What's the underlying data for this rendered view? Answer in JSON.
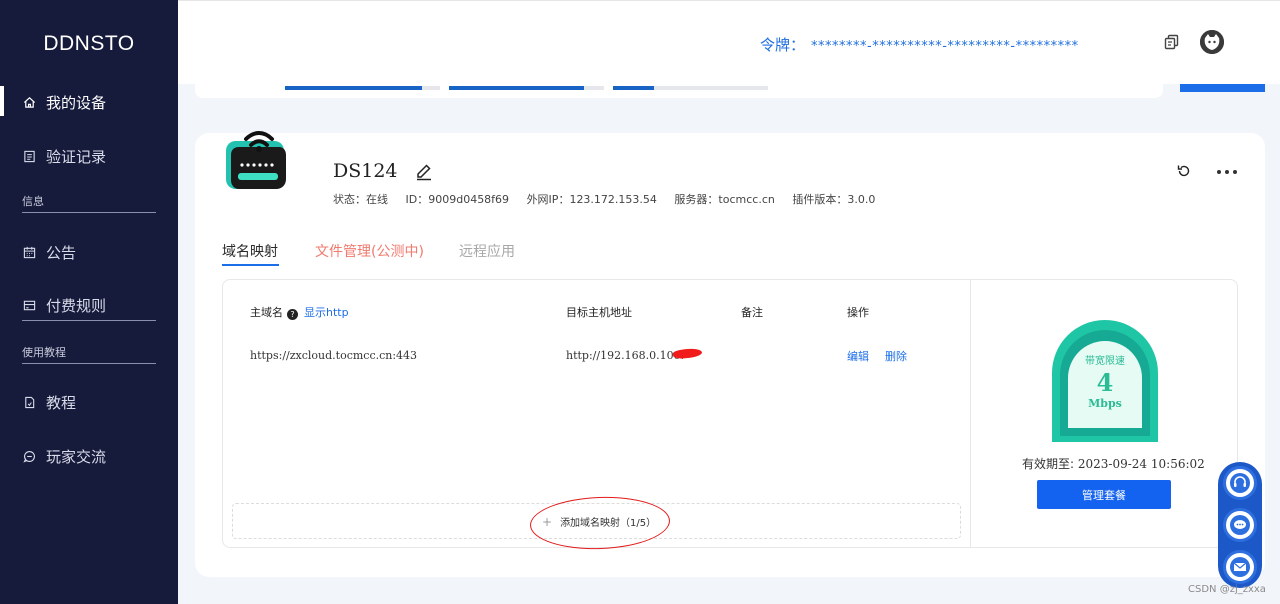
{
  "app": {
    "logo": "DDNSTO"
  },
  "sidebar": {
    "items": [
      {
        "label": "我的设备",
        "icon": "home-icon"
      },
      {
        "label": "验证记录",
        "icon": "list-icon"
      },
      {
        "label": "公告",
        "icon": "calendar-icon"
      },
      {
        "label": "付费规则",
        "icon": "card-icon"
      },
      {
        "label": "教程",
        "icon": "document-icon"
      },
      {
        "label": "玩家交流",
        "icon": "chat-icon"
      }
    ],
    "sections": {
      "info": "信息",
      "tutorial": "使用教程"
    }
  },
  "header": {
    "token_label": "令牌：",
    "token_value": "********-**********-*********-*********"
  },
  "device": {
    "name": "DS124",
    "status": "状态：在线",
    "id": "ID：9009d0458f69",
    "ip": "外网IP：123.172.153.54",
    "server": "服务器：tocmcc.cn",
    "plugin": "插件版本：3.0.0"
  },
  "tabs": [
    {
      "label": "域名映射"
    },
    {
      "label": "文件管理(公测中)"
    },
    {
      "label": "远程应用"
    }
  ],
  "table": {
    "col_domain": "主域名",
    "show_http": "显示http",
    "col_target": "目标主机地址",
    "col_note": "备注",
    "col_action": "操作",
    "rows": [
      {
        "domain": "https://zxcloud.tocmcc.cn:443",
        "target": "http://192.168.0.100:",
        "note": "",
        "edit": "编辑",
        "delete": "删除"
      }
    ],
    "add_label": "添加域名映射（1/5）"
  },
  "plan": {
    "gauge_title": "带宽限速",
    "gauge_value": "4",
    "gauge_unit": "Mbps",
    "expiry_label": "有效期至:",
    "expiry_value": "2023-09-24 10:56:02",
    "manage_label": "管理套餐"
  },
  "colors": {
    "sidebar_bg": "#161a3b",
    "accent": "#1c6ee8",
    "gauge": "#1fc6a6",
    "beta_tab": "#f07a6e"
  },
  "watermark": "CSDN @zj_zxxa"
}
